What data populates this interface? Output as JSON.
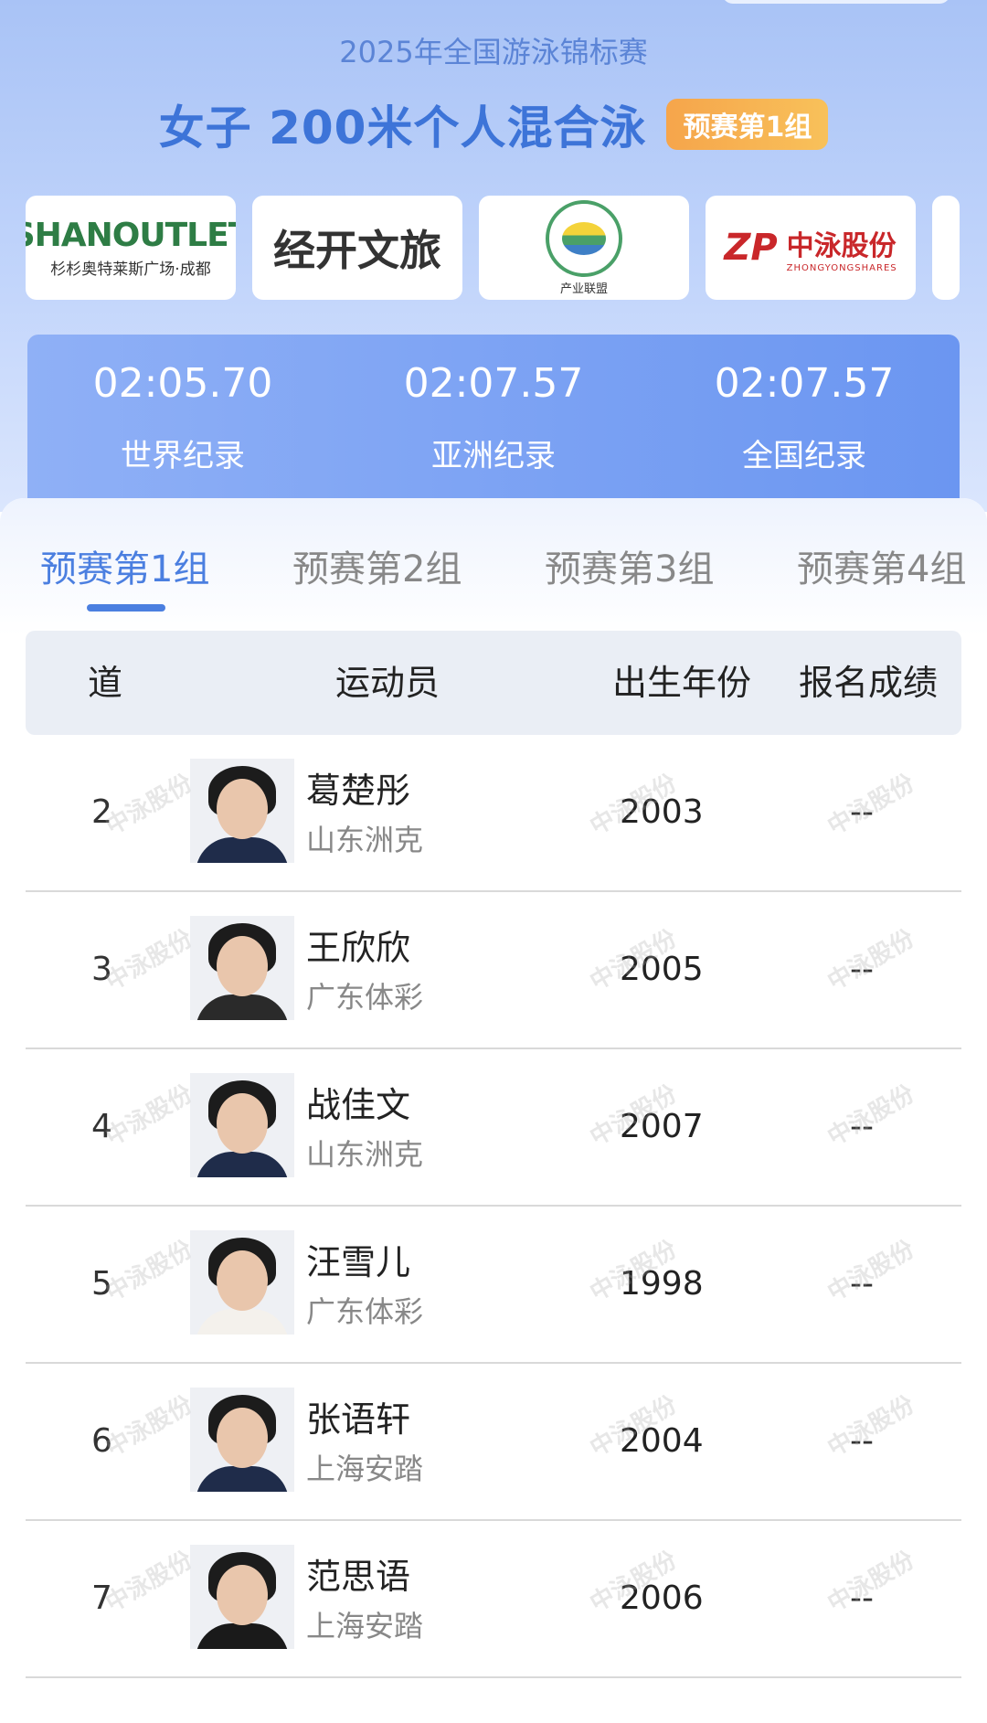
{
  "header": {
    "event_subtitle": "2025年全国游泳锦标赛",
    "event_title": "女子 200米个人混合泳",
    "group_badge": "预赛第1组"
  },
  "sponsors": [
    {
      "big": "SHANOUTLET",
      "small": "杉杉奥特莱斯广场·成都"
    },
    {
      "text": "经开文旅"
    },
    {
      "text": "产业联盟"
    },
    {
      "cn": "中泳股份",
      "en": "ZHONGYONGSHARES"
    }
  ],
  "records": [
    {
      "time": "02:05.70",
      "label": "世界纪录"
    },
    {
      "time": "02:07.57",
      "label": "亚洲纪录"
    },
    {
      "time": "02:07.57",
      "label": "全国纪录"
    }
  ],
  "tabs": [
    {
      "label": "预赛第1组",
      "active": true
    },
    {
      "label": "预赛第2组",
      "active": false
    },
    {
      "label": "预赛第3组",
      "active": false
    },
    {
      "label": "预赛第4组",
      "active": false
    }
  ],
  "table": {
    "headers": [
      "道",
      "运动员",
      "出生年份",
      "报名成绩"
    ],
    "rows": [
      {
        "lane": "2",
        "name": "葛楚彤",
        "team": "山东洲克",
        "year": "2003",
        "mark": "--"
      },
      {
        "lane": "3",
        "name": "王欣欣",
        "team": "广东体彩",
        "year": "2005",
        "mark": "--"
      },
      {
        "lane": "4",
        "name": "战佳文",
        "team": "山东洲克",
        "year": "2007",
        "mark": "--"
      },
      {
        "lane": "5",
        "name": "汪雪儿",
        "team": "广东体彩",
        "year": "1998",
        "mark": "--"
      },
      {
        "lane": "6",
        "name": "张语轩",
        "team": "上海安踏",
        "year": "2004",
        "mark": "--"
      },
      {
        "lane": "7",
        "name": "范思语",
        "team": "上海安踏",
        "year": "2006",
        "mark": "--"
      }
    ]
  },
  "watermark": "中泳股份",
  "colors": {
    "accent": "#4b7fe0",
    "badge": "#f6a54b"
  }
}
